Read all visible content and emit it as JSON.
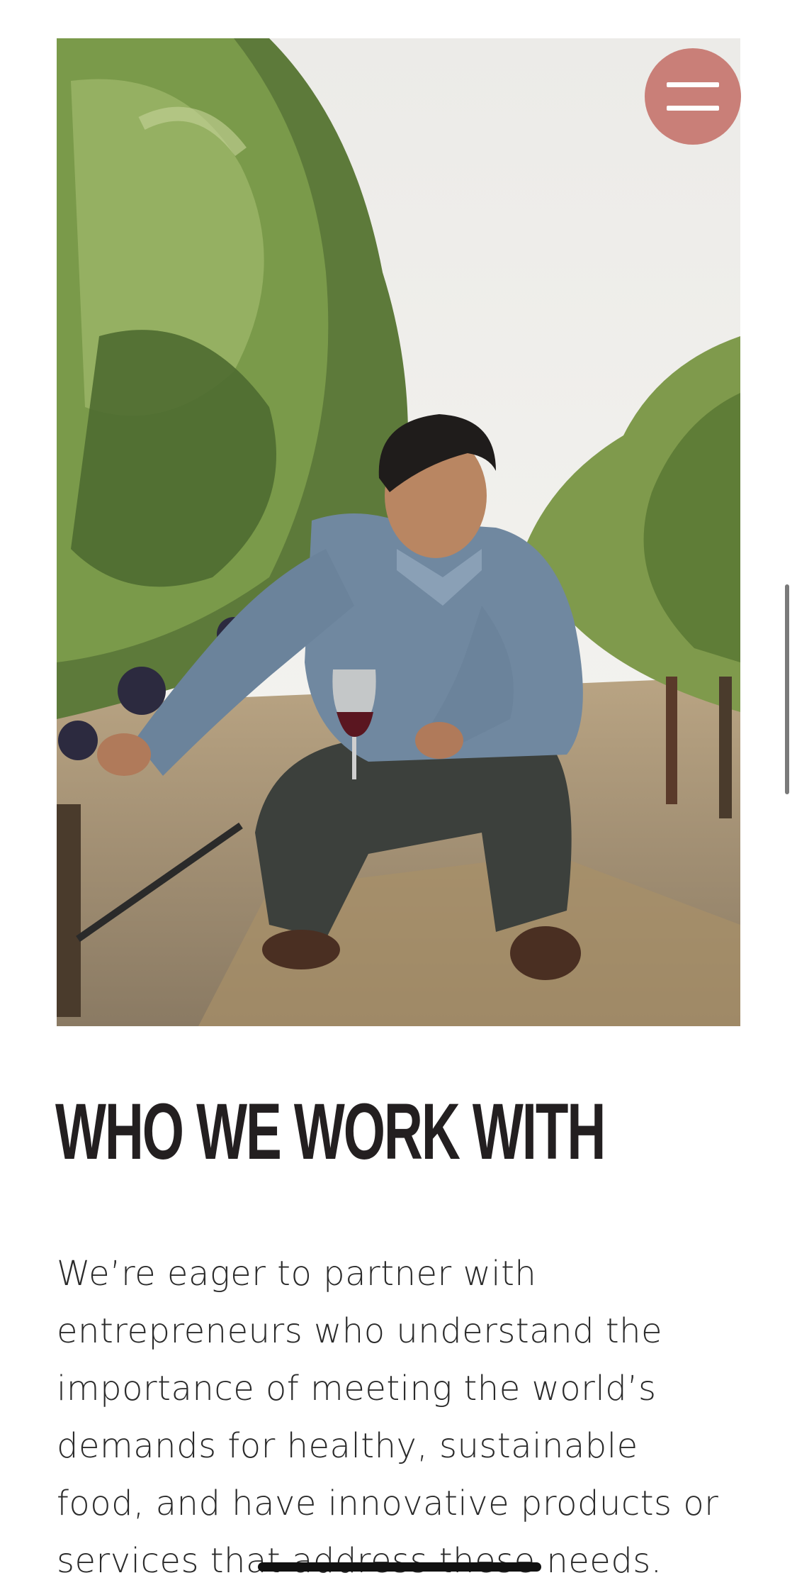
{
  "header": {
    "menu_icon": "hamburger-menu-icon",
    "menu_color": "#c97f78"
  },
  "hero": {
    "image_subject": "person crouching in vineyard inspecting grapes while holding a glass of red wine"
  },
  "section": {
    "heading": "WHO WE WORK WITH",
    "body": "We’re eager to partner with entrepreneurs who understand the importance of meeting the world’s demands for healthy, sustainable food, and have innovative products or services that address these needs."
  },
  "colors": {
    "heading": "#231f20",
    "body": "#2b2b2b",
    "accent": "#c97f78",
    "background": "#ffffff"
  }
}
